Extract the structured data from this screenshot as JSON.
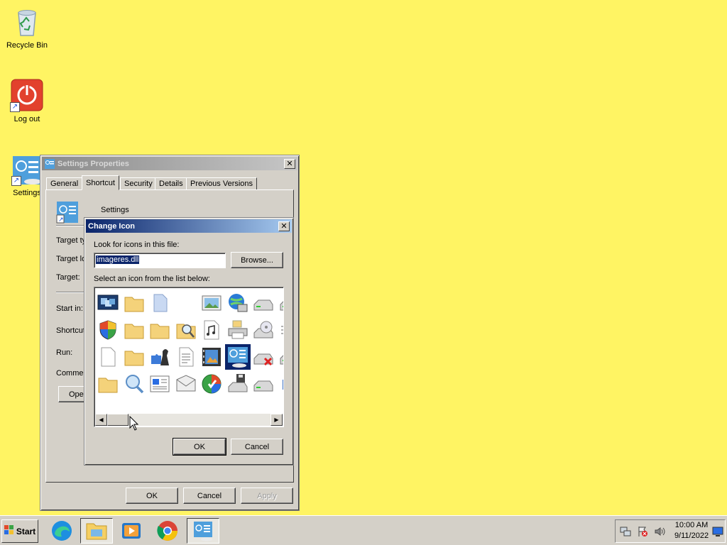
{
  "desktop": {
    "bg_color": "#fff463",
    "icons": [
      {
        "label": "Recycle Bin",
        "icon": "recycle-bin-icon"
      },
      {
        "label": "Log out",
        "icon": "power-icon"
      },
      {
        "label": "Settings",
        "icon": "settings-icon"
      }
    ]
  },
  "properties": {
    "title": "Settings Properties",
    "tabs": [
      "General",
      "Shortcut",
      "Security",
      "Details",
      "Previous Versions"
    ],
    "active_tab": "Shortcut",
    "name": "Settings",
    "fields": {
      "target_type": "Target ty",
      "target_location": "Target lo",
      "target": "Target:",
      "start_in": "Start in:",
      "shortcut_key": "Shortcut",
      "run": "Run:",
      "comment": "Commen"
    },
    "open_button": "Open",
    "ok": "OK",
    "cancel": "Cancel",
    "apply": "Apply"
  },
  "change_icon": {
    "title": "Change Icon",
    "look_label": "Look for icons in this file:",
    "file_value": "imageres.dll",
    "browse": "Browse...",
    "list_label": "Select an icon from the list below:",
    "ok": "OK",
    "cancel": "Cancel",
    "icons": [
      [
        "monitor-windows-icon",
        "folder-icon",
        "blank-doc-icon",
        "empty",
        "picture-icon",
        "globe-network-icon",
        "drive-icon",
        "drive-icon"
      ],
      [
        "shield-icon",
        "folder-icon",
        "folder-icon",
        "search-folder-icon",
        "music-doc-icon",
        "printer-icon",
        "disc-drive-icon",
        "chip-icon"
      ],
      [
        "document-icon",
        "folder-icon",
        "puzzle-chess-icon",
        "text-doc-icon",
        "film-icon",
        "settings-icon",
        "drive-x-icon",
        "drive-icon"
      ],
      [
        "folder-icon",
        "search-icon",
        "news-icon",
        "envelope-icon",
        "media-center-icon",
        "floppy-drive-icon",
        "drive-icon",
        "tools-icon"
      ]
    ],
    "selected_row": 2,
    "selected_col": 5
  },
  "taskbar": {
    "start_label": "Start",
    "apps": [
      "edge-icon",
      "file-explorer-icon",
      "media-player-icon",
      "chrome-icon",
      "settings-icon"
    ],
    "active_app": "file-explorer-icon",
    "tray": [
      "network-icon",
      "action-center-icon",
      "volume-icon"
    ],
    "time": "10:00 AM",
    "date": "9/11/2022"
  }
}
